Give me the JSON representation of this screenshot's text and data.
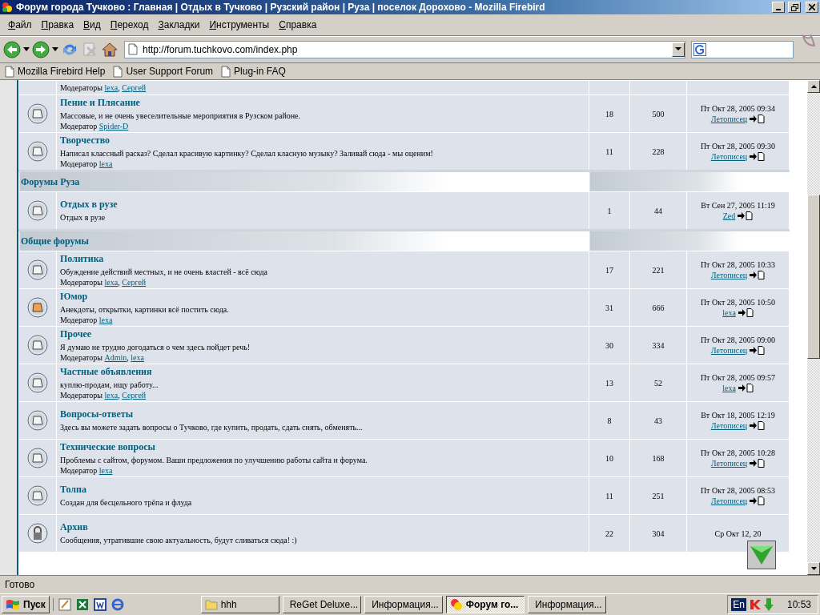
{
  "window": {
    "title": "Форум города Тучково : Главная | Отдых в Тучково | Рузский район | Руза | поселок Дорохово - Mozilla Firebird"
  },
  "menu": [
    "Файл",
    "Правка",
    "Вид",
    "Переход",
    "Закладки",
    "Инструменты",
    "Справка"
  ],
  "address": {
    "url": "http://forum.tuchkovo.com/index.php"
  },
  "bookmarks": [
    "Mozilla Firebird Help",
    "User Support Forum",
    "Plug-in FAQ"
  ],
  "forum": {
    "moderator_separator": ", ",
    "sections": [
      {
        "forums": [
          {
            "moderator_label": "Модераторы",
            "moderators": [
              "lexa",
              "Сергей"
            ]
          },
          {
            "kind": "old",
            "title": "Пение и Плясание",
            "description": "Массовые, и не очень увеселительные мероприятия в Рузском районе.",
            "moderator_label": "Модератор",
            "moderators": [
              "Spider-D"
            ],
            "topics": "18",
            "posts": "500",
            "last_date": "Пт Окт 28, 2005 09:34",
            "last_author": "Летописец"
          },
          {
            "kind": "old",
            "title": "Творчество",
            "description": "Написал классный расказ? Сделал красивую картинку? Сделал класную музыку? Заливай сюда - мы оценим!",
            "moderator_label": "Модератор",
            "moderators": [
              "lexa"
            ],
            "topics": "11",
            "posts": "228",
            "last_date": "Пт Окт 28, 2005 09:30",
            "last_author": "Летописец"
          }
        ]
      },
      {
        "title": "Форумы Руза",
        "forums": [
          {
            "kind": "old",
            "title": "Отдых в рузе",
            "description": "Отдых в рузе",
            "topics": "1",
            "posts": "44",
            "last_date": "Вт Сен 27, 2005 11:19",
            "last_author": "Zed"
          }
        ]
      },
      {
        "title": "Общие форумы",
        "forums": [
          {
            "kind": "old",
            "title": "Политика",
            "description": "Обуждение действий местных, и не очень властей - всё сюда",
            "moderator_label": "Модераторы",
            "moderators": [
              "lexa",
              "Сергей"
            ],
            "topics": "17",
            "posts": "221",
            "last_date": "Пт Окт 28, 2005 10:33",
            "last_author": "Летописец"
          },
          {
            "kind": "new",
            "title": "Юмор",
            "description": "Анекдоты, открытки, картинки всё постить сюда.",
            "moderator_label": "Модератор",
            "moderators": [
              "lexa"
            ],
            "topics": "31",
            "posts": "666",
            "last_date": "Пт Окт 28, 2005 10:50",
            "last_author": "lexa"
          },
          {
            "kind": "old",
            "title": "Прочее",
            "description": "Я думаю не трудно догодаться о чем здесь пойдет речь!",
            "moderator_label": "Модераторы",
            "moderators": [
              "Admin",
              "lexa"
            ],
            "topics": "30",
            "posts": "334",
            "last_date": "Пт Окт 28, 2005 09:00",
            "last_author": "Летописец"
          },
          {
            "kind": "old",
            "title": "Частные объявления",
            "description": "куплю-продам, ищу работу...",
            "moderator_label": "Модераторы",
            "moderators": [
              "lexa",
              "Сергей"
            ],
            "topics": "13",
            "posts": "52",
            "last_date": "Пт Окт 28, 2005 09:57",
            "last_author": "lexa"
          },
          {
            "kind": "old",
            "title": "Вопросы-ответы",
            "description": "Здесь вы можете задать вопросы о Тучково, где купить, продать, сдать снять, обменять...",
            "topics": "8",
            "posts": "43",
            "last_date": "Вт Окт 18, 2005 12:19",
            "last_author": "Летописец"
          },
          {
            "kind": "old",
            "title": "Технические вопросы",
            "description": "Проблемы с сайтом, форумом. Ваши предложения по улучшению работы сайта и форума.",
            "moderator_label": "Модератор",
            "moderators": [
              "lexa"
            ],
            "topics": "10",
            "posts": "168",
            "last_date": "Пт Окт 28, 2005 10:28",
            "last_author": "Летописец"
          },
          {
            "kind": "old",
            "title": "Толпа",
            "description": "Создан для бесцельного трёпа и флуда",
            "topics": "11",
            "posts": "251",
            "last_date": "Пт Окт 28, 2005 08:53",
            "last_author": "Летописец"
          },
          {
            "kind": "locked",
            "title": "Архив",
            "description": "Сообщения, утратившие свою актуальность, будут сливаться сюда! :)",
            "topics": "22",
            "posts": "304",
            "last_date": "Ср Окт 12, 20"
          }
        ]
      }
    ]
  },
  "status_bar": "Готово",
  "taskbar": {
    "start": "Пуск",
    "tasks": [
      {
        "label": "hhh",
        "selected": false
      },
      {
        "label": "ReGet Deluxe...",
        "selected": false
      },
      {
        "label": "Информация...",
        "selected": false
      },
      {
        "label": "Форум го...",
        "selected": true
      },
      {
        "label": "Информация...",
        "selected": false
      }
    ],
    "language": "En",
    "clock": "10:53"
  }
}
